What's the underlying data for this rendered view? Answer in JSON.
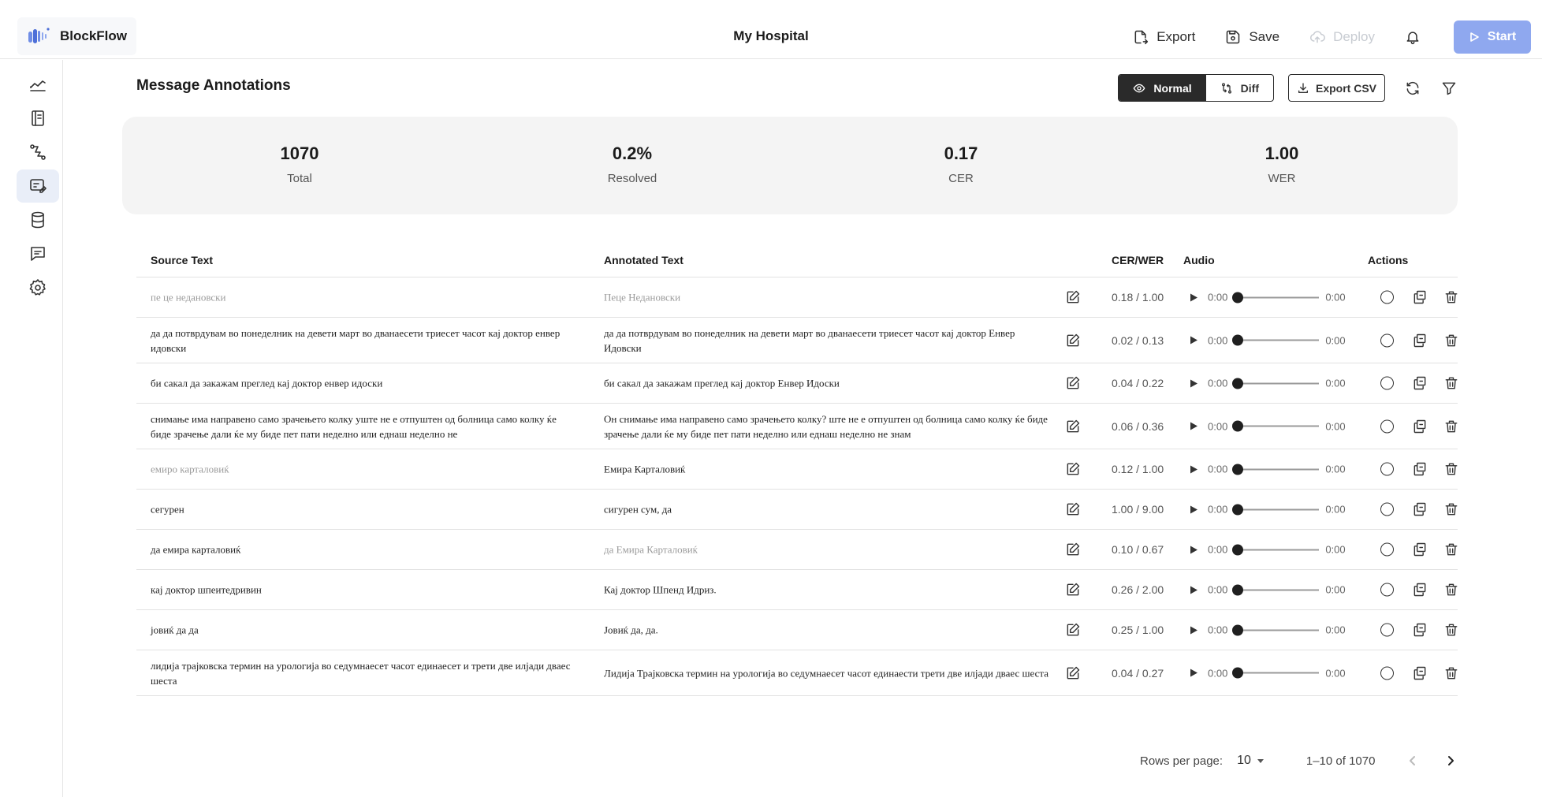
{
  "app": {
    "logo_name": "BlockFlow",
    "title": "My Hospital"
  },
  "header_actions": {
    "export": "Export",
    "save": "Save",
    "deploy": "Deploy",
    "start": "Start"
  },
  "sidebar": {
    "items": [
      {
        "icon": "dashboard-chart-icon"
      },
      {
        "icon": "notebook-icon"
      },
      {
        "icon": "workflow-icon"
      },
      {
        "icon": "annotation-icon",
        "active": true
      },
      {
        "icon": "database-icon"
      },
      {
        "icon": "chat-icon"
      },
      {
        "icon": "settings-icon"
      }
    ]
  },
  "page": {
    "title": "Message Annotations",
    "view_modes": [
      "Normal",
      "Diff"
    ],
    "active_view": "Normal",
    "export_csv": "Export CSV"
  },
  "stats": [
    {
      "value": "1070",
      "label": "Total"
    },
    {
      "value": "0.2%",
      "label": "Resolved"
    },
    {
      "value": "0.17",
      "label": "CER"
    },
    {
      "value": "1.00",
      "label": "WER"
    }
  ],
  "table": {
    "headers": {
      "source": "Source Text",
      "annotated": "Annotated Text",
      "metric": "CER/WER",
      "audio": "Audio",
      "actions": "Actions"
    },
    "rows": [
      {
        "source": "пе це недановски",
        "annotated": "Пеце Недановски",
        "metric": "0.18 / 1.00",
        "time_start": "0:00",
        "time_end": "0:00"
      },
      {
        "source": "да да потврдувам во понеделник на девети март во дванаесети триесет часот кај доктор енвер идовски",
        "annotated": "да да потврдувам во понеделник на девети март во дванаесети триесет часот кај доктор Енвер Идовски",
        "metric": "0.02 / 0.13",
        "time_start": "0:00",
        "time_end": "0:00"
      },
      {
        "source": "би сакал да закажам преглед кај доктор енвер идоски",
        "annotated": "би сакал да закажам преглед кај доктор Енвер Идоски",
        "metric": "0.04 / 0.22",
        "time_start": "0:00",
        "time_end": "0:00"
      },
      {
        "source": "снимање има направено само зрачењето колку уште не е отпуштен од болница само колку ќе биде зрачење дали ќе му биде пет пати неделно или еднаш неделно не",
        "annotated": "Он снимање има направено само зрачењето колку? ште не е отпуштен од болница само колку ќе биде зрачење дали ќе му биде пет пати неделно или еднаш неделно не знам",
        "metric": "0.06 / 0.36",
        "time_start": "0:00",
        "time_end": "0:00"
      },
      {
        "source": "емиро карталовиќ",
        "annotated": "Емира Карталовиќ",
        "metric": "0.12 / 1.00",
        "time_start": "0:00",
        "time_end": "0:00"
      },
      {
        "source": "сегурен",
        "annotated": "сигурен сум, да",
        "metric": "1.00 / 9.00",
        "time_start": "0:00",
        "time_end": "0:00"
      },
      {
        "source": "да емира карталовиќ",
        "annotated": "да Емира Карталовиќ",
        "metric": "0.10 / 0.67",
        "time_start": "0:00",
        "time_end": "0:00"
      },
      {
        "source": "кај доктор шпеитедривин",
        "annotated": "Кај доктор Шпенд Идриз.",
        "metric": "0.26 / 2.00",
        "time_start": "0:00",
        "time_end": "0:00"
      },
      {
        "source": "јовиќ да да",
        "annotated": "Јовиќ да, да.",
        "metric": "0.25 / 1.00",
        "time_start": "0:00",
        "time_end": "0:00"
      },
      {
        "source": "лидија трајковска термин на урологија во седумнаесет часот единаесет и трети две илјади дваес шеста",
        "annotated": "Лидија Трајковска термин на урологија во седумнаесет часот единаести трети две илјади дваес шеста",
        "metric": "0.04 / 0.27",
        "time_start": "0:00",
        "time_end": "0:00"
      }
    ]
  },
  "pagination": {
    "rows_per_page_label": "Rows per page:",
    "rows_per_page": "10",
    "range": "1–10 of 1070"
  },
  "colors": {
    "accent": "#8fa8ef",
    "active_nav": "#e9eef8",
    "stats_bg": "#f4f4f4"
  }
}
